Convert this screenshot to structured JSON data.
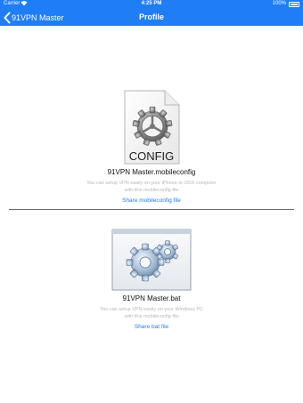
{
  "status_bar": {
    "carrier": "Carrier",
    "time": "4:25 PM",
    "battery": "100%"
  },
  "nav": {
    "back_label": "91VPN Master",
    "title": "Profile"
  },
  "config_file": {
    "icon_text": "CONFIG",
    "name": "91VPN Master.mobileconfig",
    "description_line1": "You can setup VPN easily on your iPhone or OSX computer",
    "description_line2": "with this mobileconfig file",
    "link": "Share mobileconfig file"
  },
  "bat_file": {
    "name": "91VPN Master.bat",
    "description_line1": "You can setup VPN easily on your Windows PC",
    "description_line2": "with this mobileconfig file",
    "link": "Share bat file"
  },
  "colors": {
    "accent": "#1f7ef5",
    "divider": "#6a6a6a",
    "muted_text": "#b8b8b8"
  },
  "icons": [
    "wifi-icon",
    "battery-icon",
    "back-chevron-icon",
    "config-file-icon",
    "gear-icon",
    "bat-window-icon",
    "gears-icon"
  ]
}
